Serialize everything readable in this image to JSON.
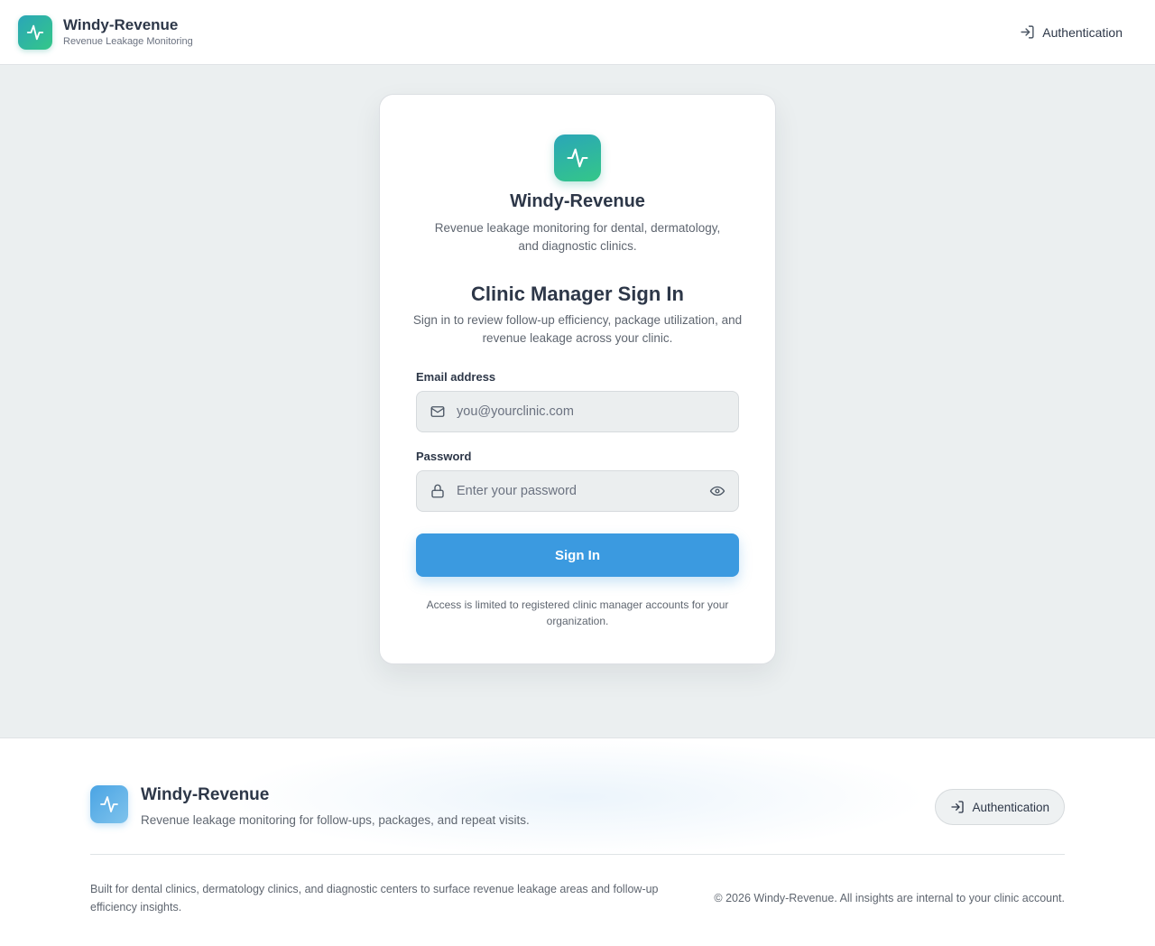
{
  "header": {
    "brand_name": "Windy-Revenue",
    "brand_tagline": "Revenue Leakage Monitoring",
    "auth_link": "Authentication"
  },
  "login_card": {
    "brand_name": "Windy-Revenue",
    "brand_description": "Revenue leakage monitoring for dental, dermatology, and diagnostic clinics.",
    "title": "Clinic Manager Sign In",
    "subtitle": "Sign in to review follow-up efficiency, package utilization, and revenue leakage across your clinic.",
    "email": {
      "label": "Email address",
      "placeholder": "you@yourclinic.com",
      "value": ""
    },
    "password": {
      "label": "Password",
      "placeholder": "Enter your password",
      "value": ""
    },
    "submit_label": "Sign In",
    "access_note": "Access is limited to registered clinic manager accounts for your organization."
  },
  "footer": {
    "brand_name": "Windy-Revenue",
    "tagline": "Revenue leakage monitoring for follow-ups, packages, and repeat visits.",
    "auth_button": "Authentication",
    "about": "Built for dental clinics, dermatology clinics, and diagnostic centers to surface revenue leakage areas and follow-up efficiency insights.",
    "copyright": "© 2026 Windy-Revenue. All insights are internal to your clinic account."
  },
  "icons": {
    "logo": "activity-pulse-icon",
    "auth": "sign-in-arrow-icon",
    "email": "mail-icon",
    "password": "lock-icon",
    "toggle_password": "eye-icon"
  },
  "colors": {
    "brand_gradient_start": "#2aa6b8",
    "brand_gradient_end": "#34c788",
    "primary_button": "#3b9ae0",
    "page_background": "#ebeff0",
    "text_primary": "#2d3748",
    "text_muted": "#5f6670"
  }
}
